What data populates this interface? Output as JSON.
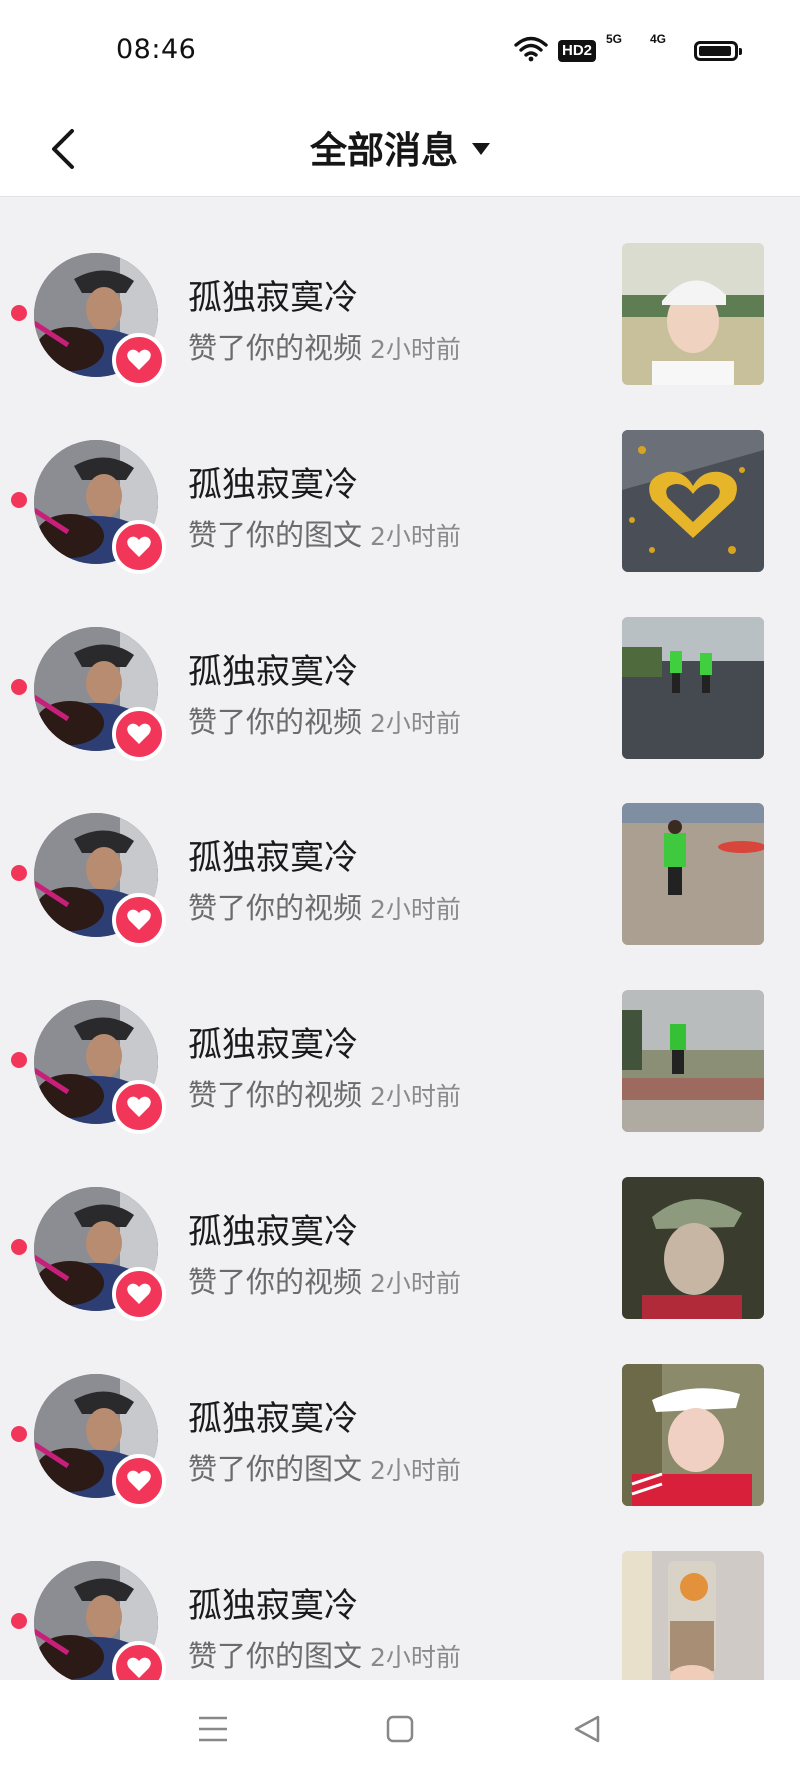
{
  "status_bar": {
    "time": "08:46",
    "hd_label": "HD2",
    "signal_1_label": "5G",
    "signal_2_label": "4G",
    "battery_level": 0.95
  },
  "header": {
    "back_icon": "chevron-left-icon",
    "title": "全部消息",
    "dropdown_icon": "caret-down-icon"
  },
  "notifications": [
    {
      "user": "孤独寂寞冷",
      "action": "赞了你的视频",
      "time": "2小时前",
      "unread": true,
      "thumb": "woman-white-cap"
    },
    {
      "user": "孤独寂寞冷",
      "action": "赞了你的图文",
      "time": "2小时前",
      "unread": true,
      "thumb": "leaf-heart"
    },
    {
      "user": "孤独寂寞冷",
      "action": "赞了你的视频",
      "time": "2小时前",
      "unread": true,
      "thumb": "runners-road"
    },
    {
      "user": "孤独寂寞冷",
      "action": "赞了你的视频",
      "time": "2小时前",
      "unread": true,
      "thumb": "runner-plaza"
    },
    {
      "user": "孤独寂寞冷",
      "action": "赞了你的视频",
      "time": "2小时前",
      "unread": true,
      "thumb": "runner-track"
    },
    {
      "user": "孤独寂寞冷",
      "action": "赞了你的视频",
      "time": "2小时前",
      "unread": true,
      "thumb": "woman-green-cap"
    },
    {
      "user": "孤独寂寞冷",
      "action": "赞了你的图文",
      "time": "2小时前",
      "unread": true,
      "thumb": "woman-visor"
    },
    {
      "user": "孤独寂寞冷",
      "action": "赞了你的图文",
      "time": "2小时前",
      "unread": true,
      "thumb": "milk-tea"
    }
  ],
  "colors": {
    "accent": "#f2365a",
    "background": "#f1f1f3",
    "surface": "#ffffff"
  },
  "nav_bar": {
    "menu_icon": "menu-icon",
    "home_icon": "square-home-icon",
    "back_icon": "triangle-back-icon"
  }
}
